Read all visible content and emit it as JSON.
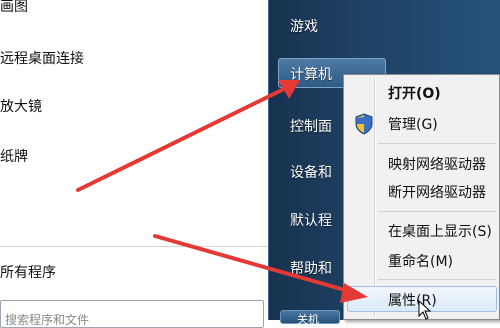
{
  "start_menu": {
    "left_items": [
      {
        "label": "画图"
      },
      {
        "label": "远程桌面连接"
      },
      {
        "label": "放大镜"
      },
      {
        "label": "纸牌"
      }
    ],
    "all_programs": "所有程序",
    "search_placeholder": "搜索程序和文件",
    "right_items": [
      {
        "label": "游戏"
      },
      {
        "label": "计算机"
      },
      {
        "label": "控制面"
      },
      {
        "label": "设备和"
      },
      {
        "label": "默认程"
      },
      {
        "label": "帮助和"
      }
    ],
    "shutdown_label": "关机"
  },
  "context_menu": {
    "items": [
      {
        "label": "打开(O)"
      },
      {
        "label": "管理(G)"
      },
      {
        "label": "映射网络驱动器"
      },
      {
        "label": "断开网络驱动器"
      },
      {
        "label": "在桌面上显示(S)"
      },
      {
        "label": "重命名(M)"
      },
      {
        "label": "属性(R)"
      }
    ]
  },
  "colors": {
    "arrow": "#e53935",
    "right_panel": "#1f4164",
    "menu_bg": "#f1f1f1",
    "hover": "#dbe9f8"
  }
}
